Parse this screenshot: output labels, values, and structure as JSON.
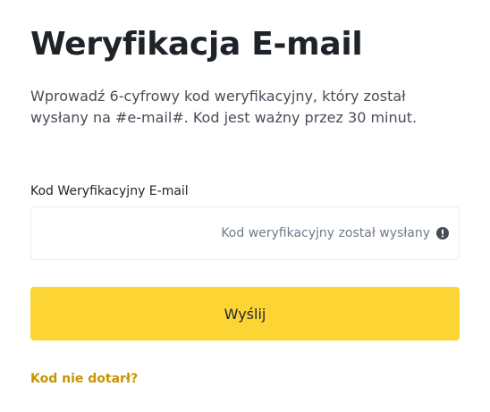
{
  "title": "Weryfikacja E-mail",
  "description": "Wprowadź 6-cyfrowy kod weryfikacyjny, który został wysłany na #e-mail#. Kod jest ważny przez 30 minut.",
  "form": {
    "label": "Kod Weryfikacyjny E-mail",
    "code_value": "",
    "sent_note": "Kod weryfikacyjny został wysłany",
    "info_icon": "exclamation-circle-icon",
    "submit_label": "Wyślij",
    "resend_link": "Kod nie dotarł?"
  },
  "colors": {
    "accent": "#fcd535",
    "link": "#c99400",
    "text_primary": "#1e2329",
    "text_secondary": "#707a8a",
    "border": "#eaecef"
  }
}
